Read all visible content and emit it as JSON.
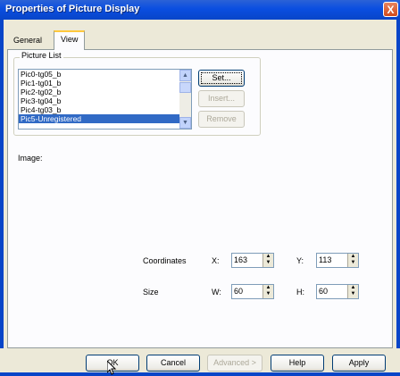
{
  "window": {
    "title": "Properties of Picture Display",
    "close_glyph": "X"
  },
  "tabs": [
    {
      "label": "General"
    },
    {
      "label": "View"
    }
  ],
  "picture_list": {
    "group_label": "Picture List",
    "items": [
      "Pic0-tg05_b",
      "Pic1-tg01_b",
      "Pic2-tg02_b",
      "Pic3-tg04_b",
      "Pic4-tg03_b",
      "Pic5-Unregistered"
    ],
    "selected_index": 5,
    "buttons": {
      "set": "Set...",
      "insert": "Insert...",
      "remove": "Remove"
    }
  },
  "image_label": "Image:",
  "coordinates": {
    "label": "Coordinates",
    "x_label": "X:",
    "x_value": "163",
    "y_label": "Y:",
    "y_value": "113"
  },
  "size": {
    "label": "Size",
    "w_label": "W:",
    "w_value": "60",
    "h_label": "H:",
    "h_value": "60"
  },
  "footer": {
    "ok": "OK",
    "cancel": "Cancel",
    "advanced": "Advanced >",
    "help": "Help",
    "apply": "Apply"
  },
  "colors": {
    "titlebar": "#0845c8",
    "selection": "#316ac5",
    "dialog_bg": "#ece9d8"
  }
}
